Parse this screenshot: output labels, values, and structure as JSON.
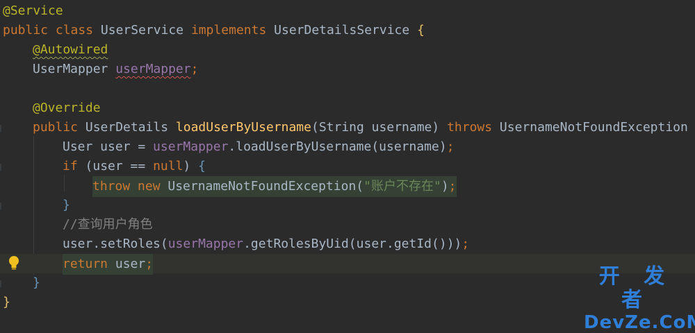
{
  "editor": {
    "language": "Java",
    "lines": [
      {
        "indent": 0,
        "tokens": [
          {
            "text": "@Service",
            "cls": "ann"
          }
        ]
      },
      {
        "indent": 0,
        "tokens": [
          {
            "text": "public class ",
            "cls": "kw"
          },
          {
            "text": "UserService ",
            "cls": "dflt"
          },
          {
            "text": "implements ",
            "cls": "kw"
          },
          {
            "text": "UserDetailsService ",
            "cls": "dflt"
          },
          {
            "text": "{",
            "cls": "brace-y"
          }
        ]
      },
      {
        "indent": 1,
        "tokens": [
          {
            "text": "@Autowired",
            "cls": "ann squig-g"
          }
        ]
      },
      {
        "indent": 1,
        "tokens": [
          {
            "text": "UserMapper ",
            "cls": "dflt"
          },
          {
            "text": "userMapper",
            "cls": "fld squig"
          },
          {
            "text": ";",
            "cls": "kw"
          }
        ]
      },
      {
        "indent": 0,
        "tokens": []
      },
      {
        "indent": 1,
        "tokens": [
          {
            "text": "@Override",
            "cls": "ann"
          }
        ]
      },
      {
        "indent": 1,
        "tokens": [
          {
            "text": "public ",
            "cls": "kw"
          },
          {
            "text": "UserDetails ",
            "cls": "dflt"
          },
          {
            "text": "loadUserByUsername",
            "cls": "meth"
          },
          {
            "text": "(String username) ",
            "cls": "dflt"
          },
          {
            "text": "throws ",
            "cls": "kw"
          },
          {
            "text": "UsernameNotFoundException ",
            "cls": "dflt"
          },
          {
            "text": "{",
            "cls": "brace-y"
          }
        ]
      },
      {
        "indent": 2,
        "tokens": [
          {
            "text": "User user = ",
            "cls": "dflt"
          },
          {
            "text": "userMapper",
            "cls": "fld"
          },
          {
            "text": ".loadUserByUsername(username)",
            "cls": "dflt"
          },
          {
            "text": ";",
            "cls": "kw"
          }
        ]
      },
      {
        "indent": 2,
        "tokens": [
          {
            "text": "if ",
            "cls": "kw"
          },
          {
            "text": "(user == ",
            "cls": "dflt"
          },
          {
            "text": "null",
            "cls": "kw"
          },
          {
            "text": ") ",
            "cls": "dflt"
          },
          {
            "text": "{",
            "cls": "paren-b"
          }
        ]
      },
      {
        "indent": 3,
        "highlight": true,
        "tokens": [
          {
            "text": "throw new ",
            "cls": "kw"
          },
          {
            "text": "UsernameNotFoundException(",
            "cls": "dflt"
          },
          {
            "text": "\"账户不存在\"",
            "cls": "str"
          },
          {
            "text": ")",
            "cls": "dflt"
          },
          {
            "text": ";",
            "cls": "kw"
          }
        ]
      },
      {
        "indent": 2,
        "tokens": [
          {
            "text": "}",
            "cls": "paren-b"
          }
        ]
      },
      {
        "indent": 2,
        "tokens": [
          {
            "text": "//查询用户角色",
            "cls": "cmt"
          }
        ]
      },
      {
        "indent": 2,
        "tokens": [
          {
            "text": "user.setRoles(",
            "cls": "dflt"
          },
          {
            "text": "userMapper",
            "cls": "fld"
          },
          {
            "text": ".getRolesByUid(user.getId()))",
            "cls": "dflt"
          },
          {
            "text": ";",
            "cls": "kw"
          }
        ]
      },
      {
        "indent": 2,
        "caret": true,
        "highlight": true,
        "tokens": [
          {
            "text": "return ",
            "cls": "kw"
          },
          {
            "text": "user",
            "cls": "dflt"
          },
          {
            "text": ";",
            "cls": "kw"
          }
        ]
      },
      {
        "indent": 1,
        "tokens": [
          {
            "text": "}",
            "cls": "paren-b"
          }
        ]
      },
      {
        "indent": 0,
        "tokens": [
          {
            "text": "}",
            "cls": "brace-y"
          }
        ]
      }
    ]
  },
  "intention_bulb": {
    "icon": "lightbulb-icon",
    "color": "#f0c020"
  },
  "watermark": {
    "line1": "开 发 者",
    "line2": "DevZe.CoM"
  },
  "colors": {
    "background": "#2b2b2b",
    "keyword": "#cc7832",
    "annotation": "#bbb529",
    "field": "#9876aa",
    "method": "#ffc66d",
    "string": "#6a8759",
    "comment": "#808080",
    "default": "#a9b7c6"
  }
}
